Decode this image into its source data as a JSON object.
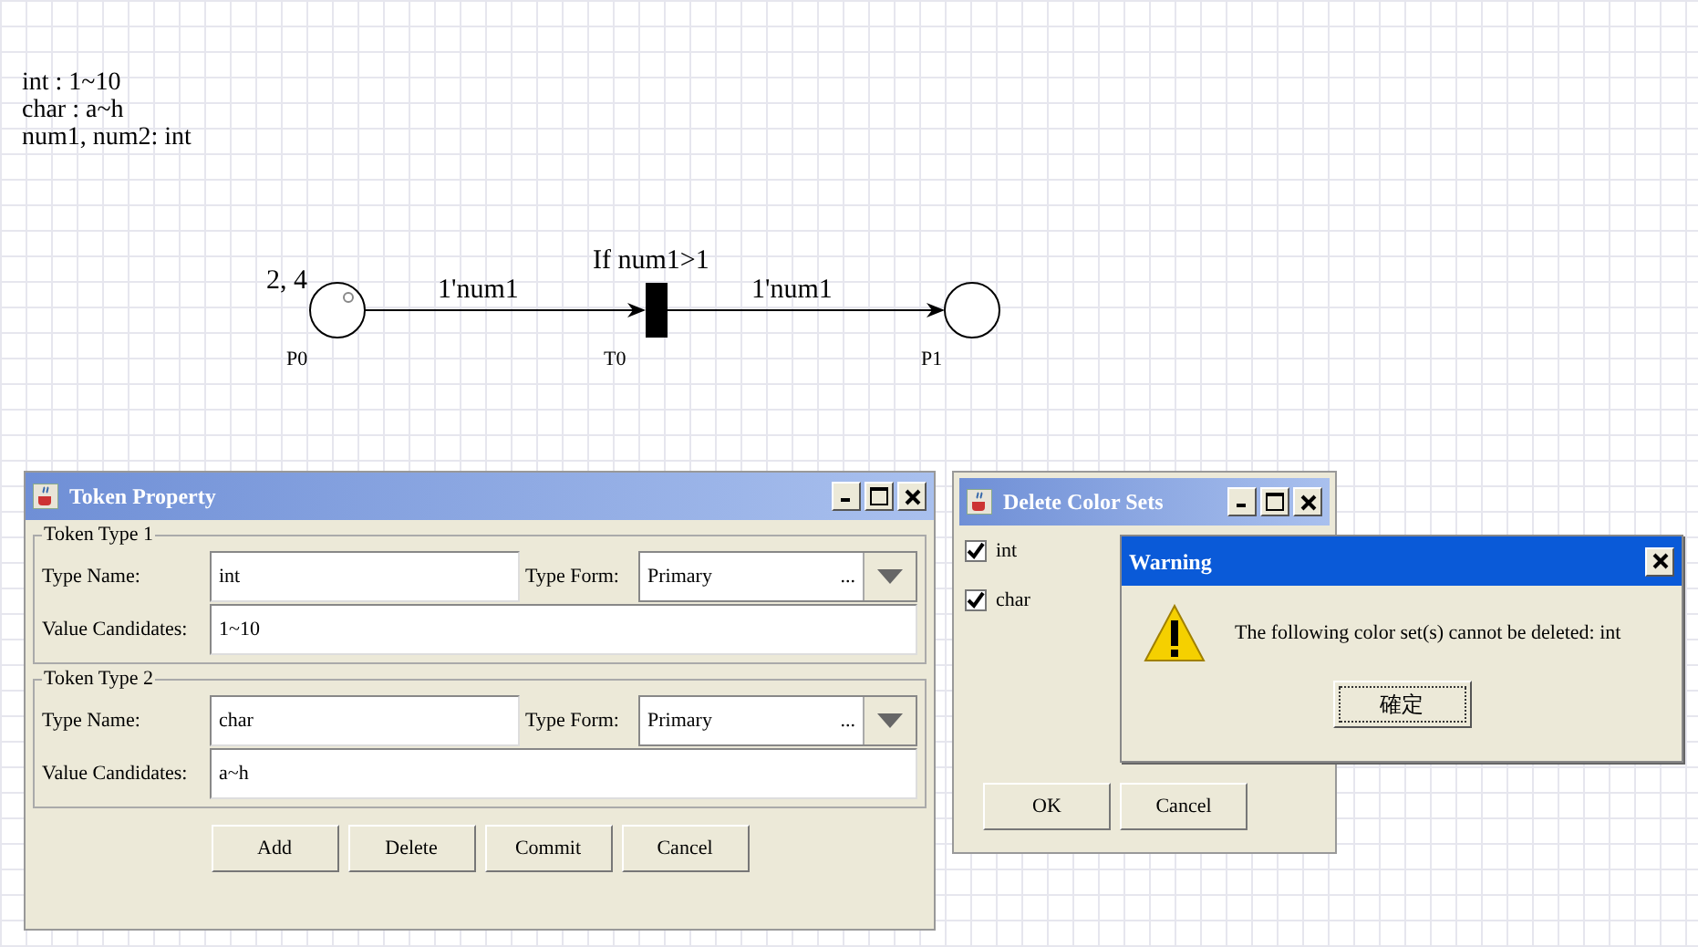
{
  "declarations": [
    "int : 1~10",
    "char : a~h",
    "num1, num2: int"
  ],
  "diagram": {
    "places": [
      {
        "name": "P0",
        "tokens": "2, 4"
      },
      {
        "name": "P1"
      }
    ],
    "transition": {
      "name": "T0",
      "guard": "If num1>1"
    },
    "arcs": [
      {
        "label": "1'num1"
      },
      {
        "label": "1'num1"
      }
    ]
  },
  "token_property": {
    "title": "Token Property",
    "groups": [
      {
        "title": "Token Type 1",
        "type_name_label": "Type Name:",
        "type_name": "int",
        "type_form_label": "Type Form:",
        "type_form": "Primary",
        "ellipsis": "...",
        "value_candidates_label": "Value Candidates:",
        "value_candidates": "1~10"
      },
      {
        "title": "Token Type 2",
        "type_name_label": "Type Name:",
        "type_name": "char",
        "type_form_label": "Type Form:",
        "type_form": "Primary",
        "ellipsis": "...",
        "value_candidates_label": "Value Candidates:",
        "value_candidates": "a~h"
      }
    ],
    "buttons": [
      "Add",
      "Delete",
      "Commit",
      "Cancel"
    ]
  },
  "delete_color_sets": {
    "title": "Delete Color Sets",
    "items": [
      {
        "label": "int",
        "checked": true
      },
      {
        "label": "char",
        "checked": true
      }
    ],
    "buttons": [
      "OK",
      "Cancel"
    ]
  },
  "warning": {
    "title": "Warning",
    "message": "The following color set(s) cannot be deleted: int",
    "button": "確定"
  }
}
